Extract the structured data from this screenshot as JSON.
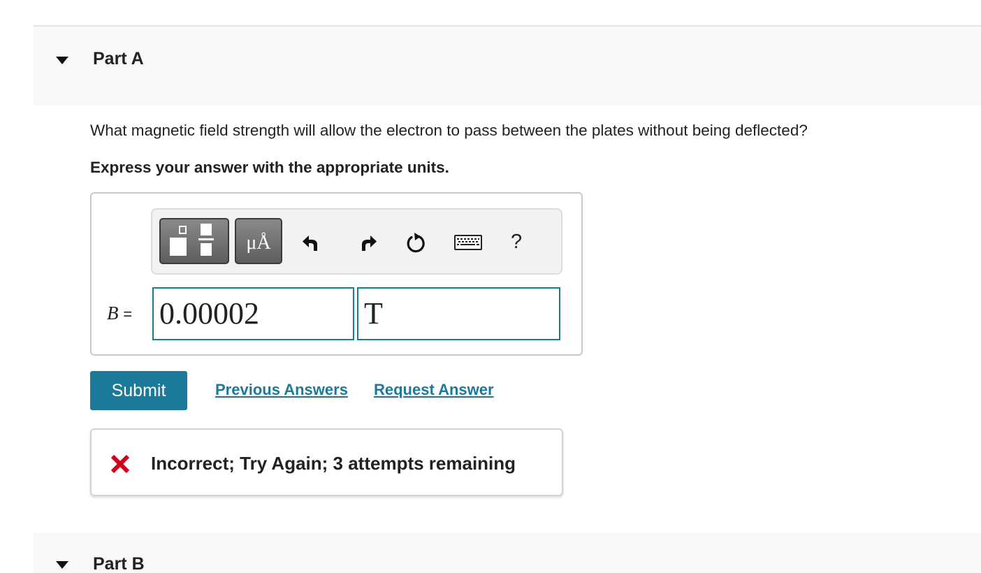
{
  "part_a": {
    "title": "Part A"
  },
  "question": {
    "text": "What magnetic field strength will allow the electron to pass between the plates without being deflected?",
    "instruction": "Express your answer with the appropriate units."
  },
  "toolbar": {
    "units_label": "μÅ",
    "help_label": "?"
  },
  "answer": {
    "variable": "B",
    "equals": "=",
    "value": "0.00002",
    "unit": "T"
  },
  "actions": {
    "submit_label": "Submit",
    "previous_answers_label": "Previous Answers",
    "request_answer_label": "Request Answer"
  },
  "feedback": {
    "text": "Incorrect; Try Again; 3 attempts remaining",
    "icon": "x-mark-icon",
    "color": "#d0021b"
  },
  "part_b": {
    "title": "Part B"
  },
  "colors": {
    "accent": "#1b7a99",
    "input_border": "#1d7a8c",
    "header_bg": "#f8f8f8"
  }
}
